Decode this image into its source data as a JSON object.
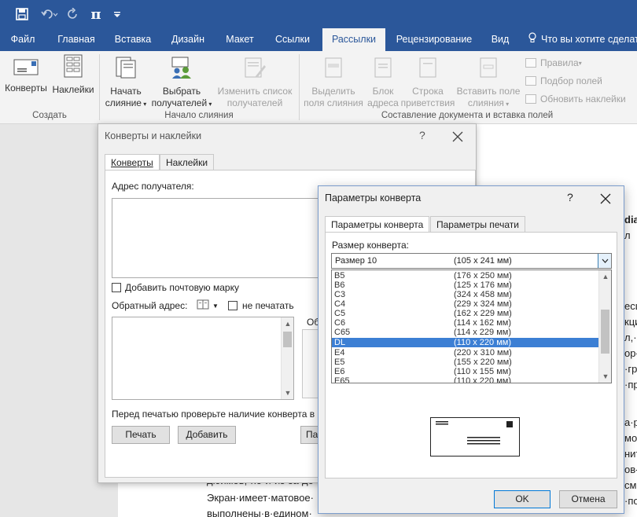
{
  "quick_access": {
    "icons": [
      "save-icon",
      "undo-icon",
      "redo-icon",
      "equation-icon",
      "customize-qat-icon"
    ],
    "pi_glyph": "π"
  },
  "tabs": [
    "Файл",
    "Главная",
    "Вставка",
    "Дизайн",
    "Макет",
    "Ссылки",
    "Рассылки",
    "Рецензирование",
    "Вид"
  ],
  "active_tab": "Рассылки",
  "tell_me": "Что вы хотите сделать",
  "ribbon": {
    "groups": {
      "create": "Создать",
      "start_merge": "Начало слияния",
      "compose": "Составление документа и вставка полей"
    },
    "buttons": {
      "envelopes": "Конверты",
      "labels": "Наклейки",
      "start_merge_1": "Начать",
      "start_merge_2": "слияние",
      "select_recipients_1": "Выбрать",
      "select_recipients_2": "получателей",
      "edit_list_1": "Изменить список",
      "edit_list_2": "получателей",
      "highlight_1": "Выделить",
      "highlight_2": "поля слияния",
      "address_block_1": "Блок",
      "address_block_2": "адреса",
      "greeting_1": "Строка",
      "greeting_2": "приветствия",
      "insert_field_1": "Вставить поле",
      "insert_field_2": "слияния"
    },
    "small": {
      "rules": "Правила",
      "match_fields": "Подбор полей",
      "update_labels": "Обновить наклейки"
    }
  },
  "dialog1": {
    "title": "Конверты и наклейки",
    "help": "?",
    "tabs": [
      "Конверты",
      "Наклейки"
    ],
    "recipient_label": "Адрес получателя:",
    "add_stamp": "Добавить почтовую марку",
    "return_label": "Обратный адрес:",
    "omit": "не печатать",
    "preview_label": "Об",
    "note": "Перед печатью проверьте наличие конверта в п",
    "print": "Печать",
    "add": "Добавить",
    "options": "Па"
  },
  "dialog2": {
    "title": "Параметры конверта",
    "help": "?",
    "tabs": [
      "Параметры конверта",
      "Параметры печати"
    ],
    "size_label": "Размер конверта:",
    "selected": {
      "name": "Размер 10",
      "size": "(105 x 241 мм)"
    },
    "list": [
      {
        "name": "B5",
        "size": "(176 x 250 мм)"
      },
      {
        "name": "B6",
        "size": "(125 x 176 мм)"
      },
      {
        "name": "C3",
        "size": "(324 x 458 мм)"
      },
      {
        "name": "C4",
        "size": "(229 x 324 мм)"
      },
      {
        "name": "C5",
        "size": "(162 x 229 мм)"
      },
      {
        "name": "C6",
        "size": "(114 x 162 мм)"
      },
      {
        "name": "C65",
        "size": "(114 x 229 мм)"
      },
      {
        "name": "DL",
        "size": "(110 x 220 мм)"
      },
      {
        "name": "E4",
        "size": "(220 x 310 мм)"
      },
      {
        "name": "E5",
        "size": "(155 x 220 мм)"
      },
      {
        "name": "E6",
        "size": "(110 x 155 мм)"
      },
      {
        "name": "E65",
        "size": "(110 x 220 мм)"
      }
    ],
    "highlighted": "DL",
    "ok": "OK",
    "cancel": "Отмена"
  },
  "document": {
    "line1": "дюймов,·но·и·из-за·до",
    "line2": "Экран·имеет·матовое·",
    "line3": "выполнены·в·едином·",
    "right_fragments": [
      "dia",
      "л",
      "есц",
      "кци",
      "л,·чт",
      "ор-·",
      "·гр",
      "·пр",
      "a·р",
      "мос",
      "ниту",
      "ов-",
      "см·",
      "·по"
    ]
  },
  "colors": {
    "title_bar": "#2b579a",
    "selection": "#3c7fd4"
  }
}
